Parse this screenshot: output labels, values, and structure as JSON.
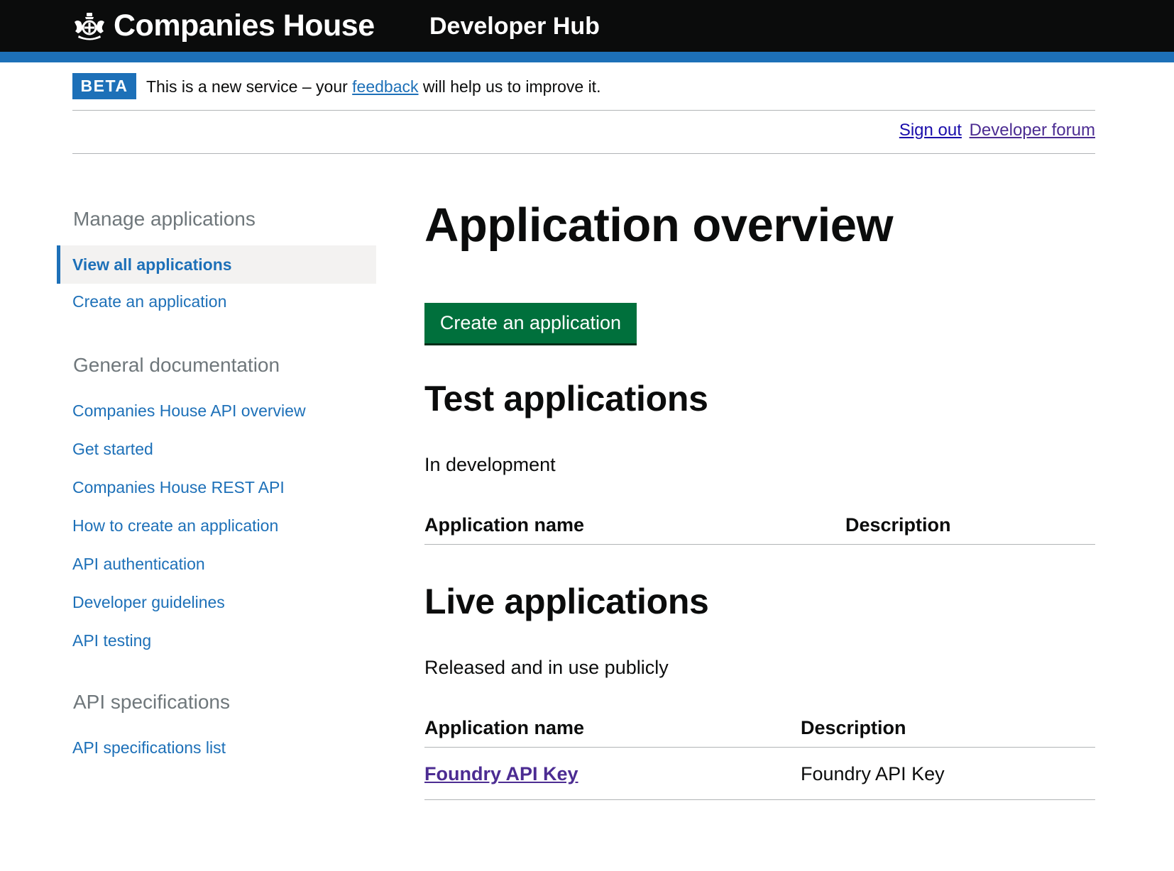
{
  "header": {
    "brand": "Companies House",
    "service_name": "Developer Hub",
    "colors": {
      "background": "#0b0c0c",
      "bar": "#1d70b8"
    }
  },
  "phase_banner": {
    "tag": "BETA",
    "text_before": "This is a new service – your ",
    "link_text": "feedback",
    "text_after": " will help us to improve it."
  },
  "utility_links": {
    "sign_out": "Sign out",
    "developer_forum": "Developer forum"
  },
  "sidebar": {
    "sections": [
      {
        "heading": "Manage applications",
        "items": [
          {
            "label": "View all applications",
            "active": true
          },
          {
            "label": "Create an application"
          }
        ]
      },
      {
        "heading": "General documentation",
        "items": [
          {
            "label": "Companies House API overview"
          },
          {
            "label": "Get started"
          },
          {
            "label": "Companies House REST API"
          },
          {
            "label": "How to create an application"
          },
          {
            "label": "API authentication"
          },
          {
            "label": "Developer guidelines"
          },
          {
            "label": "API testing"
          }
        ]
      },
      {
        "heading": "API specifications",
        "items": [
          {
            "label": "API specifications list"
          }
        ]
      }
    ]
  },
  "main": {
    "title": "Application overview",
    "create_button": "Create an application",
    "button_color": "#00703c",
    "test_section": {
      "title": "Test applications",
      "description": "In development",
      "columns": [
        "Application name",
        "Description"
      ],
      "rows": []
    },
    "live_section": {
      "title": "Live applications",
      "description": "Released and in use publicly",
      "columns": [
        "Application name",
        "Description"
      ],
      "rows": [
        {
          "name": "Foundry API Key",
          "description": "Foundry API Key"
        }
      ]
    }
  }
}
